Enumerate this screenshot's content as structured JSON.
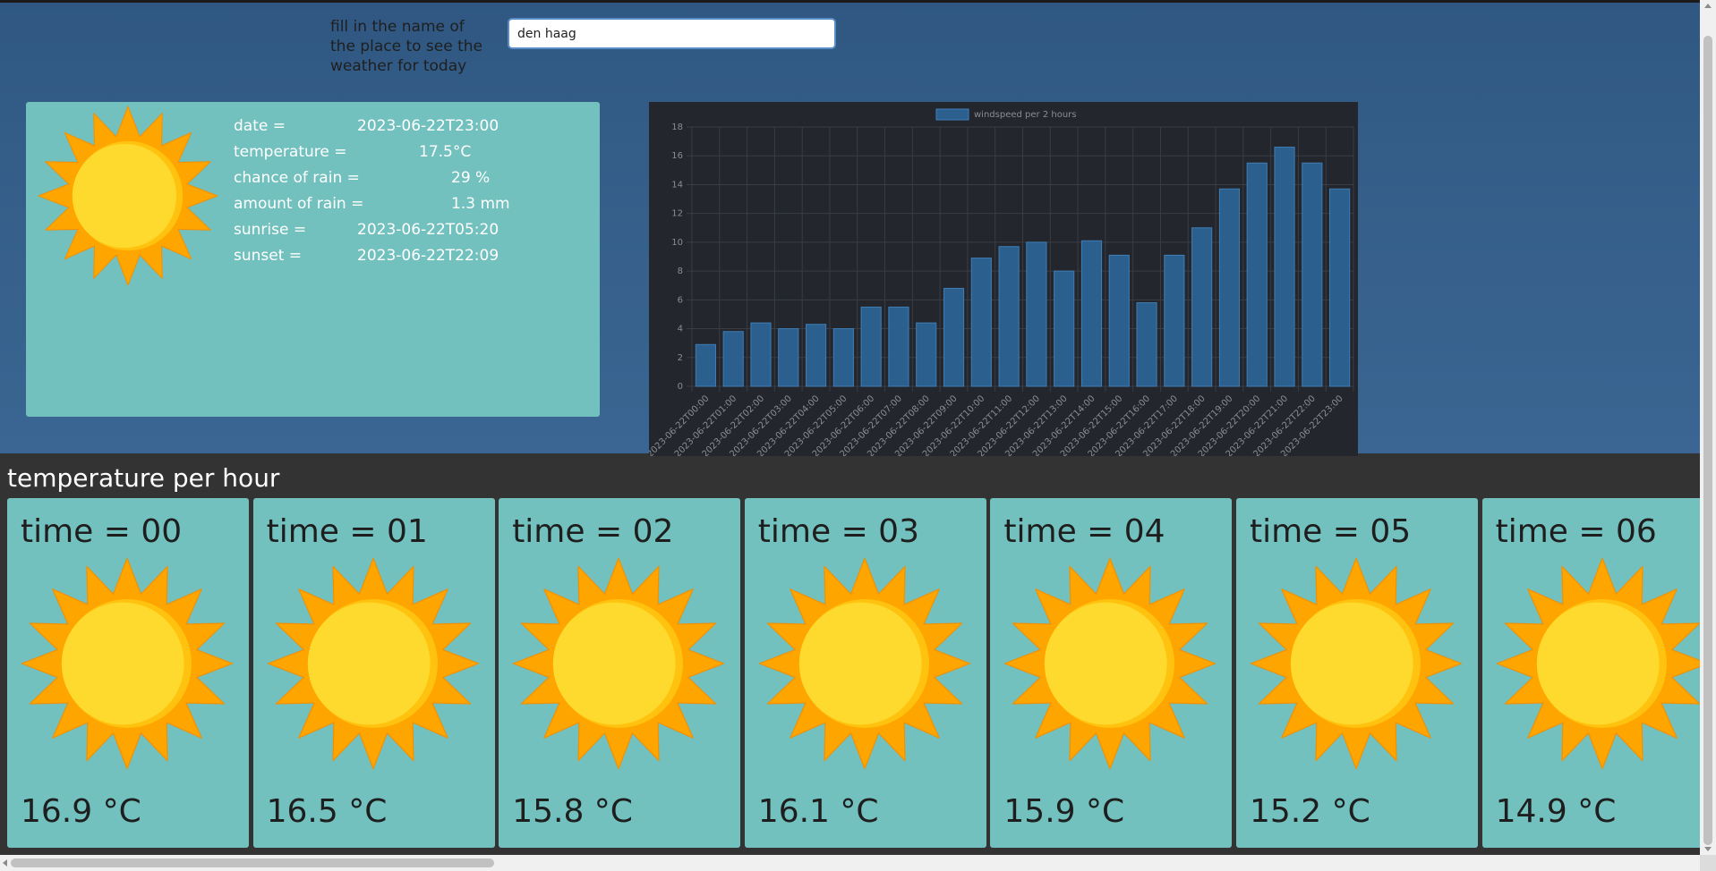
{
  "search": {
    "label": "fill in the name of the place to see the weather for today",
    "value": "den haag"
  },
  "today": {
    "icon": "sun-icon",
    "rows": [
      {
        "key": "date =",
        "value": "2023-06-22T23:00"
      },
      {
        "key": "temperature =",
        "value": "17.5°C"
      },
      {
        "key": "chance of rain =",
        "value": "29 %"
      },
      {
        "key": "amount of rain =",
        "value": "1.3 mm"
      },
      {
        "key": "sunrise =",
        "value": "2023-06-22T05:20"
      },
      {
        "key": "sunset =",
        "value": "2023-06-22T22:09"
      }
    ]
  },
  "chart_data": {
    "type": "bar",
    "legend": "windspeed per 2 hours",
    "legend_position": "top",
    "categories": [
      "2023-06-22T00:00",
      "2023-06-22T01:00",
      "2023-06-22T02:00",
      "2023-06-22T03:00",
      "2023-06-22T04:00",
      "2023-06-22T05:00",
      "2023-06-22T06:00",
      "2023-06-22T07:00",
      "2023-06-22T08:00",
      "2023-06-22T09:00",
      "2023-06-22T10:00",
      "2023-06-22T11:00",
      "2023-06-22T12:00",
      "2023-06-22T13:00",
      "2023-06-22T14:00",
      "2023-06-22T15:00",
      "2023-06-22T16:00",
      "2023-06-22T17:00",
      "2023-06-22T18:00",
      "2023-06-22T19:00",
      "2023-06-22T20:00",
      "2023-06-22T21:00",
      "2023-06-22T22:00",
      "2023-06-22T23:00"
    ],
    "series": [
      {
        "name": "windspeed per 2 hours",
        "values": [
          2.9,
          3.8,
          4.4,
          4.0,
          4.3,
          4.0,
          5.5,
          5.5,
          4.4,
          6.8,
          8.9,
          9.7,
          10.0,
          8.0,
          10.1,
          9.1,
          5.8,
          9.1,
          11.0,
          13.7,
          15.5,
          16.6,
          15.5,
          13.7
        ]
      }
    ],
    "yticks": [
      "0",
      "2",
      "4",
      "6",
      "8",
      "10",
      "12",
      "14",
      "16",
      "18"
    ],
    "ylim": [
      0,
      18
    ],
    "grid": true,
    "colors": {
      "bar": "#2b5f8e",
      "bar_border": "#3f7db5",
      "grid": "#3a3d44",
      "tick": "#8a8d92"
    }
  },
  "hourly": {
    "title": "temperature per hour",
    "cards": [
      {
        "time": "time = 00",
        "temp": "16.9 °C",
        "icon": "sun-icon"
      },
      {
        "time": "time = 01",
        "temp": "16.5 °C",
        "icon": "sun-icon"
      },
      {
        "time": "time = 02",
        "temp": "15.8 °C",
        "icon": "sun-icon"
      },
      {
        "time": "time = 03",
        "temp": "16.1 °C",
        "icon": "sun-icon"
      },
      {
        "time": "time = 04",
        "temp": "15.9 °C",
        "icon": "sun-icon"
      },
      {
        "time": "time = 05",
        "temp": "15.2 °C",
        "icon": "sun-icon"
      },
      {
        "time": "time = 06",
        "temp": "14.9 °C",
        "icon": "sun-icon"
      }
    ]
  },
  "colors": {
    "card": "#72c1be",
    "header_bg": "#36608b",
    "page_bg": "#333333",
    "sun_outer": "#ffa500",
    "sun_inner": "#ffda2e"
  }
}
